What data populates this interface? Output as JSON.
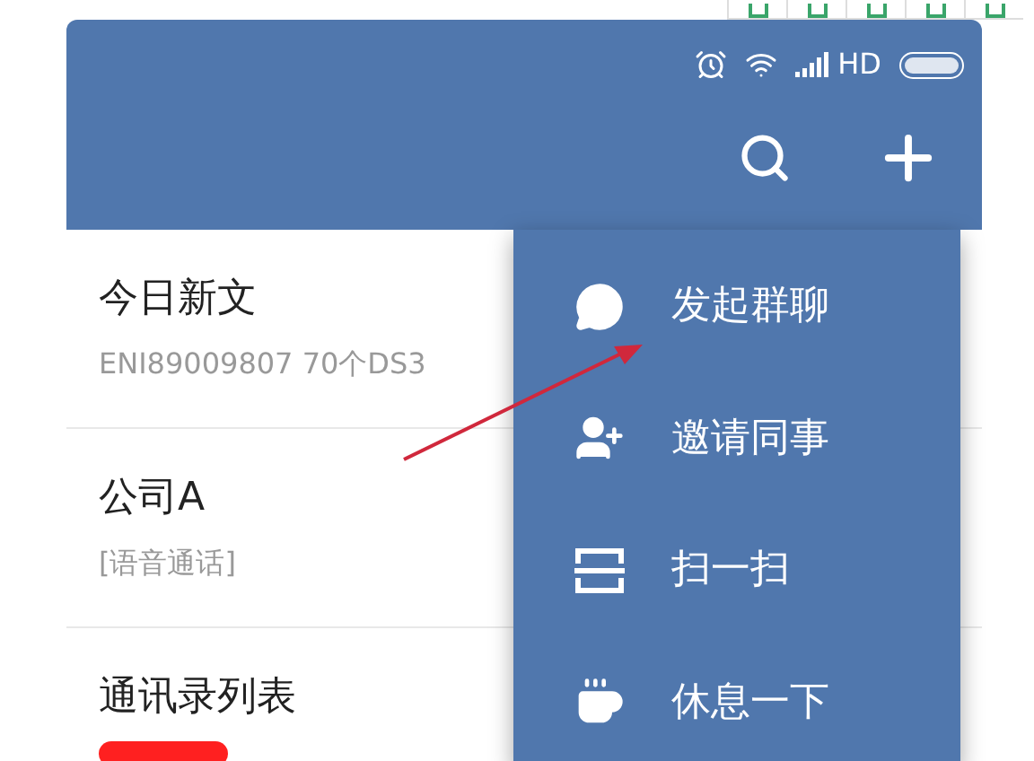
{
  "status_bar": {
    "network": "HD"
  },
  "conversations": [
    {
      "title": "今日新文",
      "preview": "ENI89009807 70个DS3"
    },
    {
      "title": "公司A",
      "preview": "[语音通话]"
    },
    {
      "title": "通讯录列表",
      "redacted": true
    }
  ],
  "menu": {
    "items": [
      {
        "kind": "chat",
        "label": "发起群聊"
      },
      {
        "kind": "invite",
        "label": "邀请同事"
      },
      {
        "kind": "scan",
        "label": "扫一扫"
      },
      {
        "kind": "break",
        "label": "休息一下"
      }
    ]
  }
}
